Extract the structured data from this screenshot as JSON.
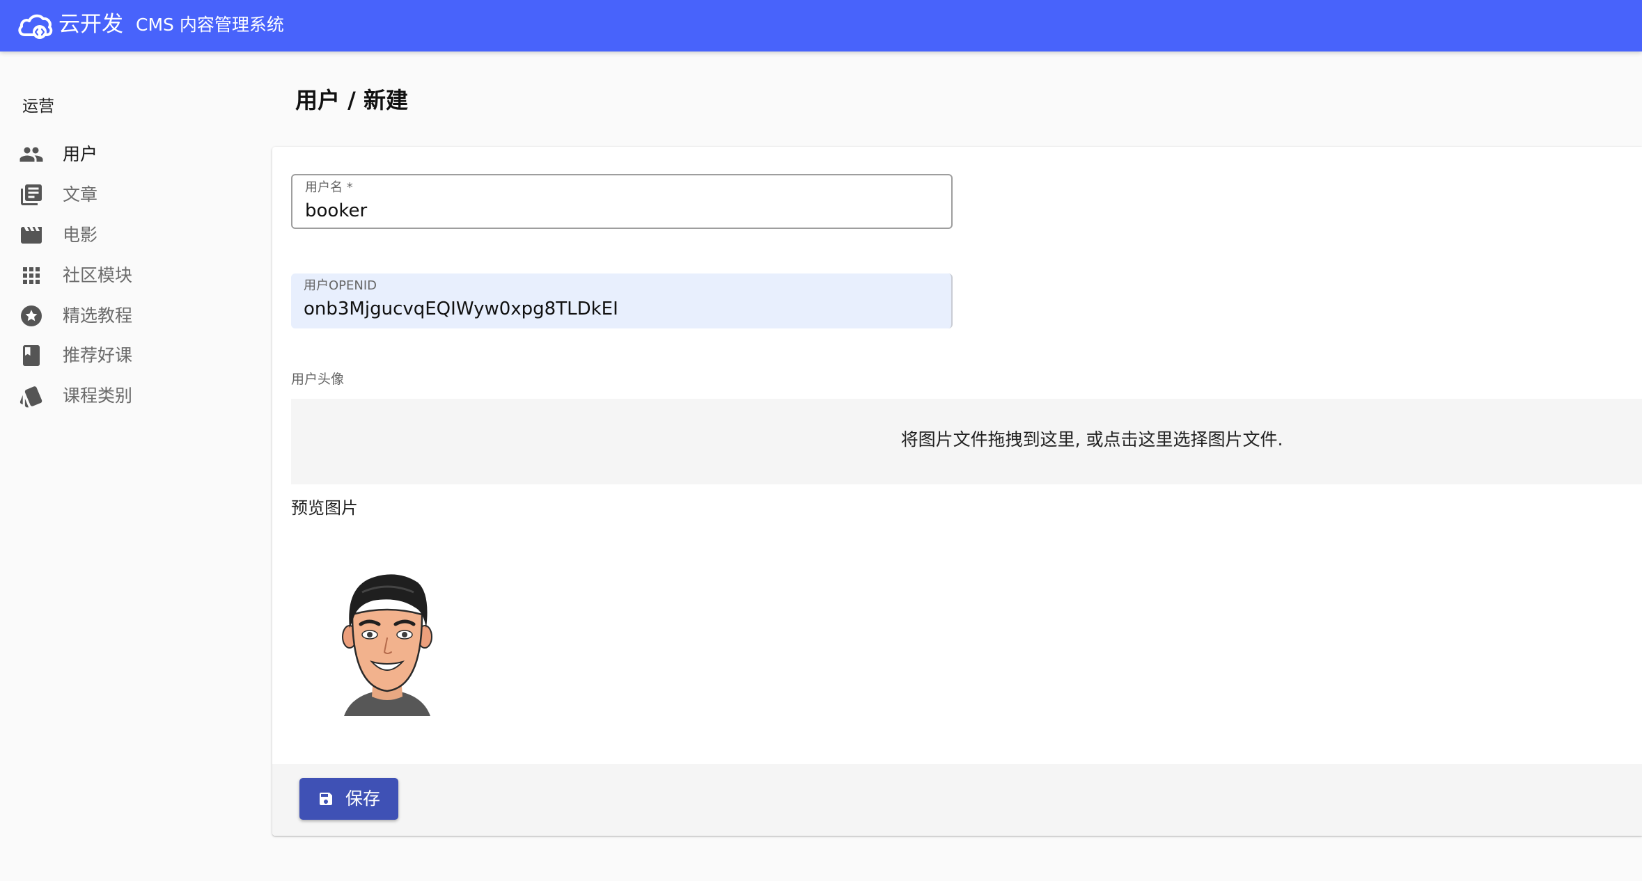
{
  "header": {
    "brand": "云开发",
    "title": "CMS 内容管理系统",
    "logo_icon": "cloud-code-icon",
    "background_color": "#4863fb"
  },
  "sidebar": {
    "section_label": "运营",
    "items": [
      {
        "label": "用户",
        "icon": "people-icon",
        "active": true
      },
      {
        "label": "文章",
        "icon": "library-books-icon",
        "active": false
      },
      {
        "label": "电影",
        "icon": "movie-icon",
        "active": false
      },
      {
        "label": "社区模块",
        "icon": "apps-grid-icon",
        "active": false
      },
      {
        "label": "精选教程",
        "icon": "star-circle-icon",
        "active": false
      },
      {
        "label": "推荐好课",
        "icon": "bookmark-book-icon",
        "active": false
      },
      {
        "label": "课程类别",
        "icon": "category-cards-icon",
        "active": false
      }
    ]
  },
  "page": {
    "title": "用户 / 新建"
  },
  "form": {
    "username": {
      "label": "用户名 *",
      "value": "booker"
    },
    "openid": {
      "label": "用户OPENID",
      "value": "onb3MjgucvqEQIWyw0xpg8TLDkEI"
    },
    "avatar": {
      "label": "用户头像",
      "dropzone_text": "将图片文件拖拽到这里, 或点击这里选择图片文件."
    },
    "preview": {
      "label": "预览图片"
    }
  },
  "toolbar": {
    "save_label": "保存",
    "save_icon": "save-icon",
    "button_color": "#3f51b5"
  }
}
